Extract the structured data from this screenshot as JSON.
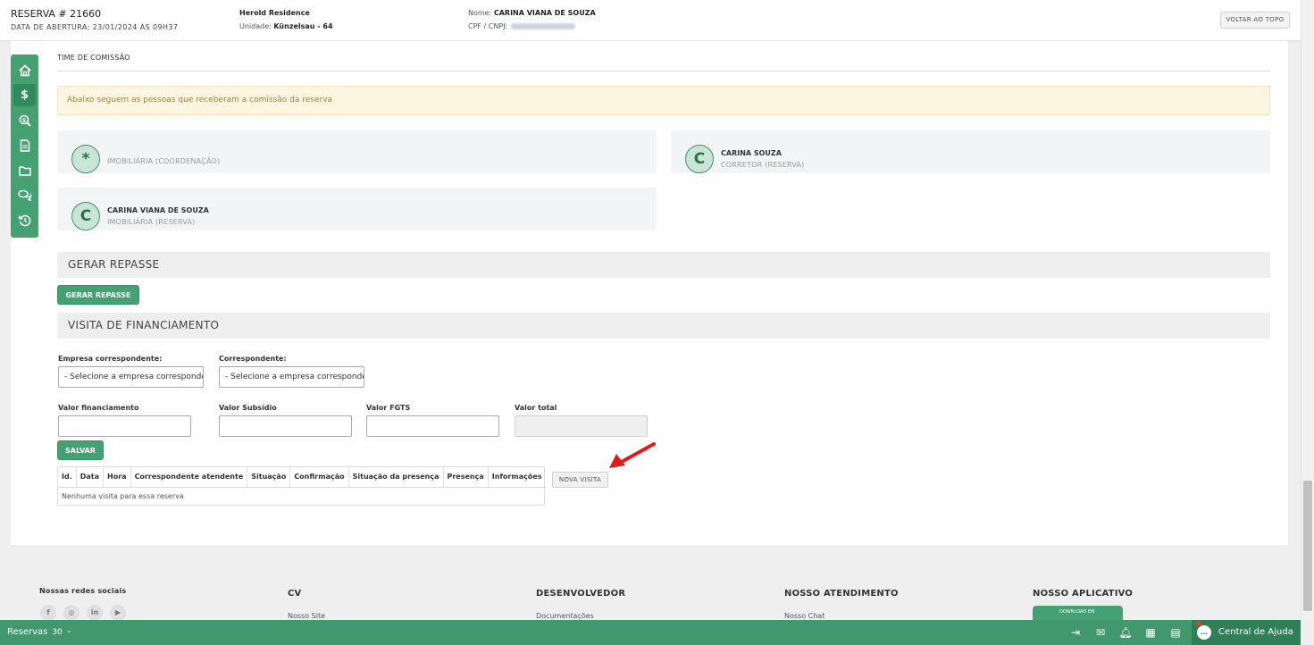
{
  "header": {
    "reservation_title": "RESERVA # 21660",
    "opening_date": "DATA DE ABERTURA: 23/01/2024 ÀS 09H37",
    "project_name": "Herold Residence",
    "unit_label": "Unidade:",
    "unit_value": "Künzelsau - 64",
    "client_label": "Nome:",
    "client_name": "CARINA VIANA DE SOUZA",
    "doc_label": "CPF / CNPJ:",
    "back_to_top": "VOLTAR AO TOPO"
  },
  "sidebar": {
    "icons": [
      "home-icon",
      "dollar-icon",
      "search-money-icon",
      "document-icon",
      "folder-icon",
      "chat-icon",
      "history-icon"
    ],
    "active_index": 1
  },
  "commission": {
    "section_title": "TIME DE COMISSÃO",
    "alert_text": "Abaixo seguem as pessoas que receberam a comissão da reserva",
    "people": [
      {
        "avatar": "*",
        "name": "",
        "role": "IMOBILIÁRIA (COORDENAÇÃO)"
      },
      {
        "avatar": "C",
        "name": "CARINA SOUZA",
        "role": "CORRETOR (RESERVA)"
      },
      {
        "avatar": "C",
        "name": "CARINA VIANA DE SOUZA",
        "role": "IMOBILIÁRIA (RESERVA)"
      }
    ]
  },
  "repasse": {
    "section_title": "GERAR REPASSE",
    "button_label": "GERAR REPASSE"
  },
  "financing": {
    "section_title": "VISITA DE FINANCIAMENTO",
    "empresa_label": "Empresa correspondente:",
    "empresa_value": "- Selecione a empresa correspondente -",
    "correspondente_label": "Correspondente:",
    "correspondente_value": "- Selecione a empresa correspondente -",
    "valor_financiamento_label": "Valor financiamento",
    "valor_subsidio_label": "Valor Subsídio",
    "valor_fgts_label": "Valor FGTS",
    "valor_total_label": "Valor total",
    "save_button": "SALVAR",
    "table_headers": [
      "Id.",
      "Data",
      "Hora",
      "Correspondente atendente",
      "Situação",
      "Confirmação",
      "Situação da presença",
      "Presença",
      "Informações"
    ],
    "empty_message": "Nenhuma visita para essa reserva",
    "new_visit_button": "NOVA VISITA",
    "annotation_color": "#e11b1b"
  },
  "footer": {
    "social_title": "Nossas redes sociais",
    "social_icons": [
      "f",
      "◎",
      "in",
      "▶"
    ],
    "cols": [
      {
        "title": "CV",
        "link": "Nosso Site"
      },
      {
        "title": "DESENVOLVEDOR",
        "link": "Documentações"
      },
      {
        "title": "NOSSO ATENDIMENTO",
        "link": "Nosso Chat"
      },
      {
        "title": "NOSSO APLICATIVO",
        "link": ""
      }
    ],
    "app_badge_small": "DOWNLOAD EM"
  },
  "bottombar": {
    "reservas_label": "Reservas",
    "reservas_count": "30",
    "help_label": "Central de Ajuda"
  },
  "colors": {
    "accent": "#45a072",
    "alert_bg": "#fcf6e0",
    "alert_text": "#a6803a"
  }
}
